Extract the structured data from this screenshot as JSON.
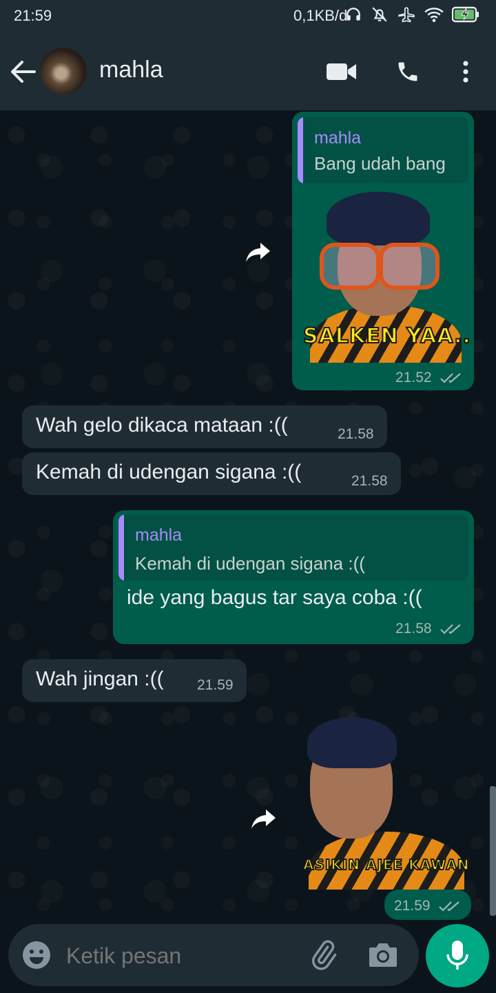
{
  "status_bar": {
    "time": "21:59",
    "network_speed": "0,1KB/d"
  },
  "header": {
    "contact_name": "mahla"
  },
  "icons": {
    "back": "arrow-left-icon",
    "video": "video-camera-icon",
    "call": "phone-icon",
    "more": "more-vert-icon",
    "forward": "forward-icon",
    "emoji": "emoji-icon",
    "attach": "paperclip-icon",
    "camera": "camera-icon",
    "mic": "microphone-icon",
    "read": "double-check-icon"
  },
  "colors": {
    "outgoing": "#005c4b",
    "incoming": "#1f2c34",
    "quote_bar": "#a78bfa",
    "fab": "#00a884",
    "background": "#0b141a"
  },
  "messages": [
    {
      "id": "m1",
      "direction": "out",
      "type": "sticker_reply",
      "quote": {
        "author": "mahla",
        "text": "Bang udah bang"
      },
      "sticker_caption": "SALKEN YAA..",
      "time": "21.52",
      "status": "read"
    },
    {
      "id": "m2",
      "direction": "in",
      "text": "Wah gelo dikaca mataan :((",
      "time": "21.58"
    },
    {
      "id": "m3",
      "direction": "in",
      "text": "Kemah di udengan sigana :((",
      "time": "21.58"
    },
    {
      "id": "m4",
      "direction": "out",
      "type": "text_reply",
      "quote": {
        "author": "mahla",
        "text": "Kemah di udengan sigana :(("
      },
      "text": "ide yang bagus tar saya coba :((",
      "time": "21.58",
      "status": "read"
    },
    {
      "id": "m5",
      "direction": "in",
      "text": "Wah jingan :((",
      "time": "21.59"
    },
    {
      "id": "m6",
      "direction": "out",
      "type": "sticker",
      "sticker_caption": "ASIKIN AJEE KAWAN...",
      "time": "21.59",
      "status": "read"
    }
  ],
  "composer": {
    "placeholder": "Ketik pesan"
  }
}
